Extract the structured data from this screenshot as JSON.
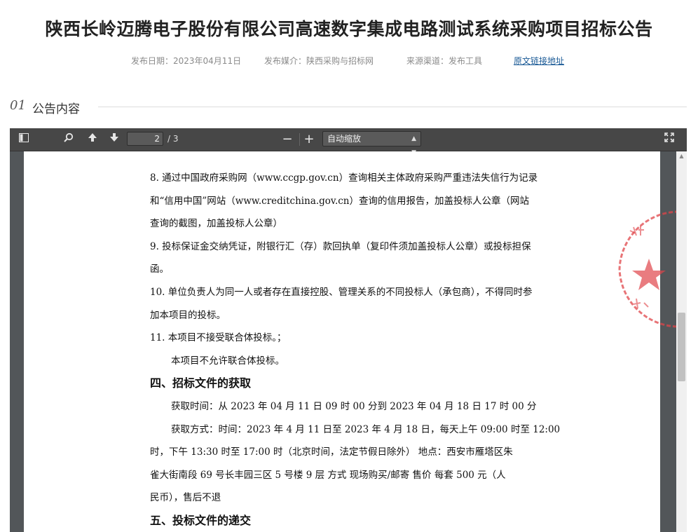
{
  "page_title": "陕西长岭迈腾电子股份有限公司高速数字集成电路测试系统采购项目招标公告",
  "meta": {
    "date": "发布日期：2023年04月11日",
    "media": "发布媒介：陕西采购与招标网",
    "source": "来源渠道：发布工具",
    "link": "原文链接地址"
  },
  "section": {
    "number": "01",
    "label": "公告内容"
  },
  "viewer": {
    "current_page": "2",
    "total_pages": "/ 3",
    "zoom": "自动缩放",
    "icons": {
      "sidebar": "sidebar-toggle-icon",
      "search": "search-icon",
      "prev": "arrow-up-icon",
      "next": "arrow-down-icon",
      "zoom_out": "minus-icon",
      "zoom_in": "plus-icon",
      "fullscreen": "expand-icon"
    }
  },
  "document": {
    "lines": [
      "8. 通过中国政府采购网（www.ccgp.gov.cn）查询相关主体政府采购严重违法失信行为记录",
      "和“信用中国”网站（www.creditchina.gov.cn）查询的信用报告，加盖投标人公章（网站",
      "查询的截图，加盖投标人公章）",
      "9. 投标保证金交纳凭证，附银行汇（存）款回执单（复印件须加盖投标人公章）或投标担保",
      "函。",
      "10. 单位负责人为同一人或者存在直接控股、管理关系的不同投标人（承包商），不得同时参",
      "加本项目的投标。",
      "11. 本项目不接受联合体投标。；",
      "本项目不允许联合体投标。",
      "四、招标文件的获取",
      "获取时间：从 2023 年 04 月 11 日  09 时 00 分到 2023 年 04 月 18 日  17 时 00 分",
      "获取方式：时间：2023 年 4 月 11 日至 2023 年 4 月 18 日，每天上午 09:00 时至 12:00",
      "时，下午 13:30 时至 17:00 时（北京时间，法定节假日除外）      地点：西安市雁塔区朱",
      "雀大街南段 69 号长丰园三区 5 号楼 9 层      方式  现场购买/邮寄      售价  每套 500 元（人",
      "民币），售后不退",
      "五、投标文件的递交"
    ]
  },
  "colors": {
    "toolbar": "#474747",
    "link": "#1a5a96",
    "seal": "#e0454a"
  }
}
